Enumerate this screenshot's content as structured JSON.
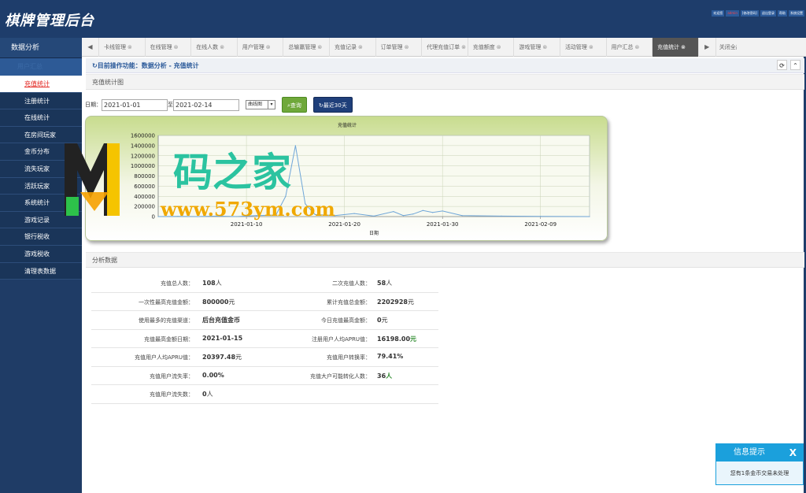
{
  "app": {
    "title": "棋牌管理后台",
    "top_links": [
      "欢迎您",
      "admin",
      "[修改密码]",
      "退出登录",
      "帮助",
      "系统设置"
    ]
  },
  "sidebar": {
    "title": "数据分析",
    "group": "用户汇总",
    "items": [
      {
        "label": "充值统计",
        "active": true
      },
      {
        "label": "注册统计"
      },
      {
        "label": "在线统计"
      },
      {
        "label": "在房间玩家"
      },
      {
        "label": "金币分布"
      },
      {
        "label": "流失玩家"
      },
      {
        "label": "活跃玩家"
      },
      {
        "label": "系统统计"
      },
      {
        "label": "游戏记录"
      },
      {
        "label": "银行税收"
      },
      {
        "label": "游戏税收"
      },
      {
        "label": "清理表数据"
      }
    ]
  },
  "tabs": {
    "left_arrow": "◀",
    "right_arrow": "▶",
    "close_all": "关闭全部",
    "close_glyph": "⊗",
    "items": [
      {
        "label": "卡线管理"
      },
      {
        "label": "在线管理"
      },
      {
        "label": "在线人数"
      },
      {
        "label": "用户管理"
      },
      {
        "label": "总输赢管理"
      },
      {
        "label": "充值记录"
      },
      {
        "label": "订单管理"
      },
      {
        "label": "代理充值订单"
      },
      {
        "label": "充值额度"
      },
      {
        "label": "游戏管理"
      },
      {
        "label": "活动管理"
      },
      {
        "label": "用户汇总"
      },
      {
        "label": "充值统计",
        "active": true
      }
    ]
  },
  "breadcrumb": {
    "text": "↻目前操作功能：数据分析 - 充值统计",
    "refresh_icon": "⟳",
    "collapse_icon": "⌃"
  },
  "chart_section": {
    "title": "充值统计图",
    "date_label": "日期：",
    "to_label": "至",
    "date_from": "2021-01-01",
    "date_to": "2021-02-14",
    "chart_type": "曲线图",
    "query_button": "查询",
    "recent_button": "最近30天"
  },
  "chart_data": {
    "type": "line",
    "title": "充值统计",
    "xlabel": "日期",
    "ylabel": "",
    "x_range": [
      "2021-01-01",
      "2021-02-14"
    ],
    "x_ticks": [
      "2021-01-10",
      "2021-01-20",
      "2021-01-30",
      "2021-02-09"
    ],
    "y_ticks": [
      0,
      200000,
      400000,
      600000,
      800000,
      1000000,
      1200000,
      1400000,
      1600000
    ],
    "ylim": [
      0,
      1600000
    ],
    "grid": true,
    "series": [
      {
        "x": [
          "2021-01-01",
          "2021-01-03",
          "2021-01-05",
          "2021-01-07",
          "2021-01-09",
          "2021-01-11",
          "2021-01-13",
          "2021-01-14",
          "2021-01-15",
          "2021-01-16",
          "2021-01-17",
          "2021-01-19",
          "2021-01-21",
          "2021-01-23",
          "2021-01-25",
          "2021-01-26",
          "2021-01-27",
          "2021-01-28",
          "2021-01-29",
          "2021-01-30",
          "2021-02-01",
          "2021-02-05",
          "2021-02-09",
          "2021-02-14"
        ],
        "values": [
          0,
          5000,
          0,
          10000,
          0,
          20000,
          30000,
          400000,
          1400000,
          250000,
          40000,
          20000,
          60000,
          10000,
          100000,
          20000,
          50000,
          120000,
          80000,
          110000,
          20000,
          10000,
          5000,
          0
        ]
      }
    ]
  },
  "watermark": {
    "text": "码之家",
    "url": "www.573ym.com"
  },
  "analysis": {
    "title": "分析数据",
    "rows": [
      {
        "l1": "充值总人数：",
        "v1": "108",
        "u1": "人",
        "l2": "二次充值人数：",
        "v2": "58",
        "u2": "人"
      },
      {
        "l1": "一次性最高充值金额：",
        "v1": "800000",
        "u1": "元",
        "l2": "累计充值总金额：",
        "v2": "2202928",
        "u2": "元"
      },
      {
        "l1": "使用最多的充值渠道：",
        "v1": "后台充值金币",
        "u1": "",
        "l2": "今日充值最高金额：",
        "v2": "0",
        "u2": "元"
      },
      {
        "l1": "充值最高金额日期：",
        "v1": "2021-01-15",
        "u1": "",
        "l2": "注册用户人均APRU值：",
        "v2": "16198.00",
        "u2": "元"
      },
      {
        "l1": "充值用户人均APRU值：",
        "v1": "20397.48",
        "u1": "元",
        "l2": "充值用户转换率：",
        "v2": "79.41%",
        "u2": ""
      },
      {
        "l1": "充值用户流失率：",
        "v1": "0.00%",
        "u1": "",
        "l2": "充值大户可能转化人数：",
        "v2": "36",
        "u2": "人"
      },
      {
        "l1": "充值用户流失数：",
        "v1": "0",
        "u1": "人",
        "l2": "",
        "v2": "",
        "u2": ""
      }
    ]
  },
  "notification": {
    "title": "信息提示",
    "close": "X",
    "message": "您有1条金币交易未处理"
  }
}
